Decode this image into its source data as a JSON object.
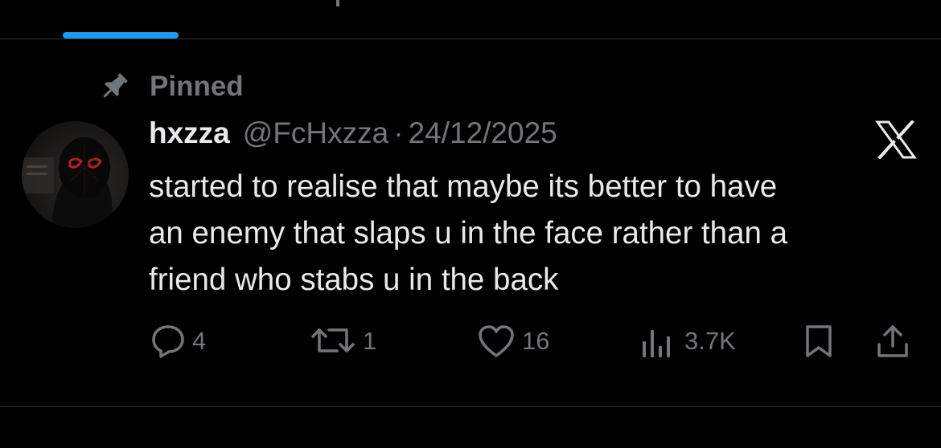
{
  "pinned": {
    "label": "Pinned",
    "icon": "pin-icon"
  },
  "author": {
    "display_name": "hxzza",
    "handle": "@FcHxzza",
    "separator": "·",
    "date": "24/12/2025"
  },
  "tweet": {
    "text": "started to realise that maybe its better to have\nan enemy that slaps u in the face rather than a\nfriend who stabs u in the back"
  },
  "actions": {
    "reply": {
      "count": "4",
      "icon": "reply-icon"
    },
    "repost": {
      "count": "1",
      "icon": "repost-icon"
    },
    "like": {
      "count": "16",
      "icon": "heart-icon"
    },
    "views": {
      "count": "3.7K",
      "icon": "views-icon"
    },
    "bookmark": {
      "icon": "bookmark-icon"
    },
    "share": {
      "icon": "share-icon"
    }
  },
  "colors": {
    "background": "#000000",
    "text_primary": "#e7e9ea",
    "text_secondary": "#71767b",
    "accent": "#1d9bf0",
    "divider": "#2f3336"
  }
}
